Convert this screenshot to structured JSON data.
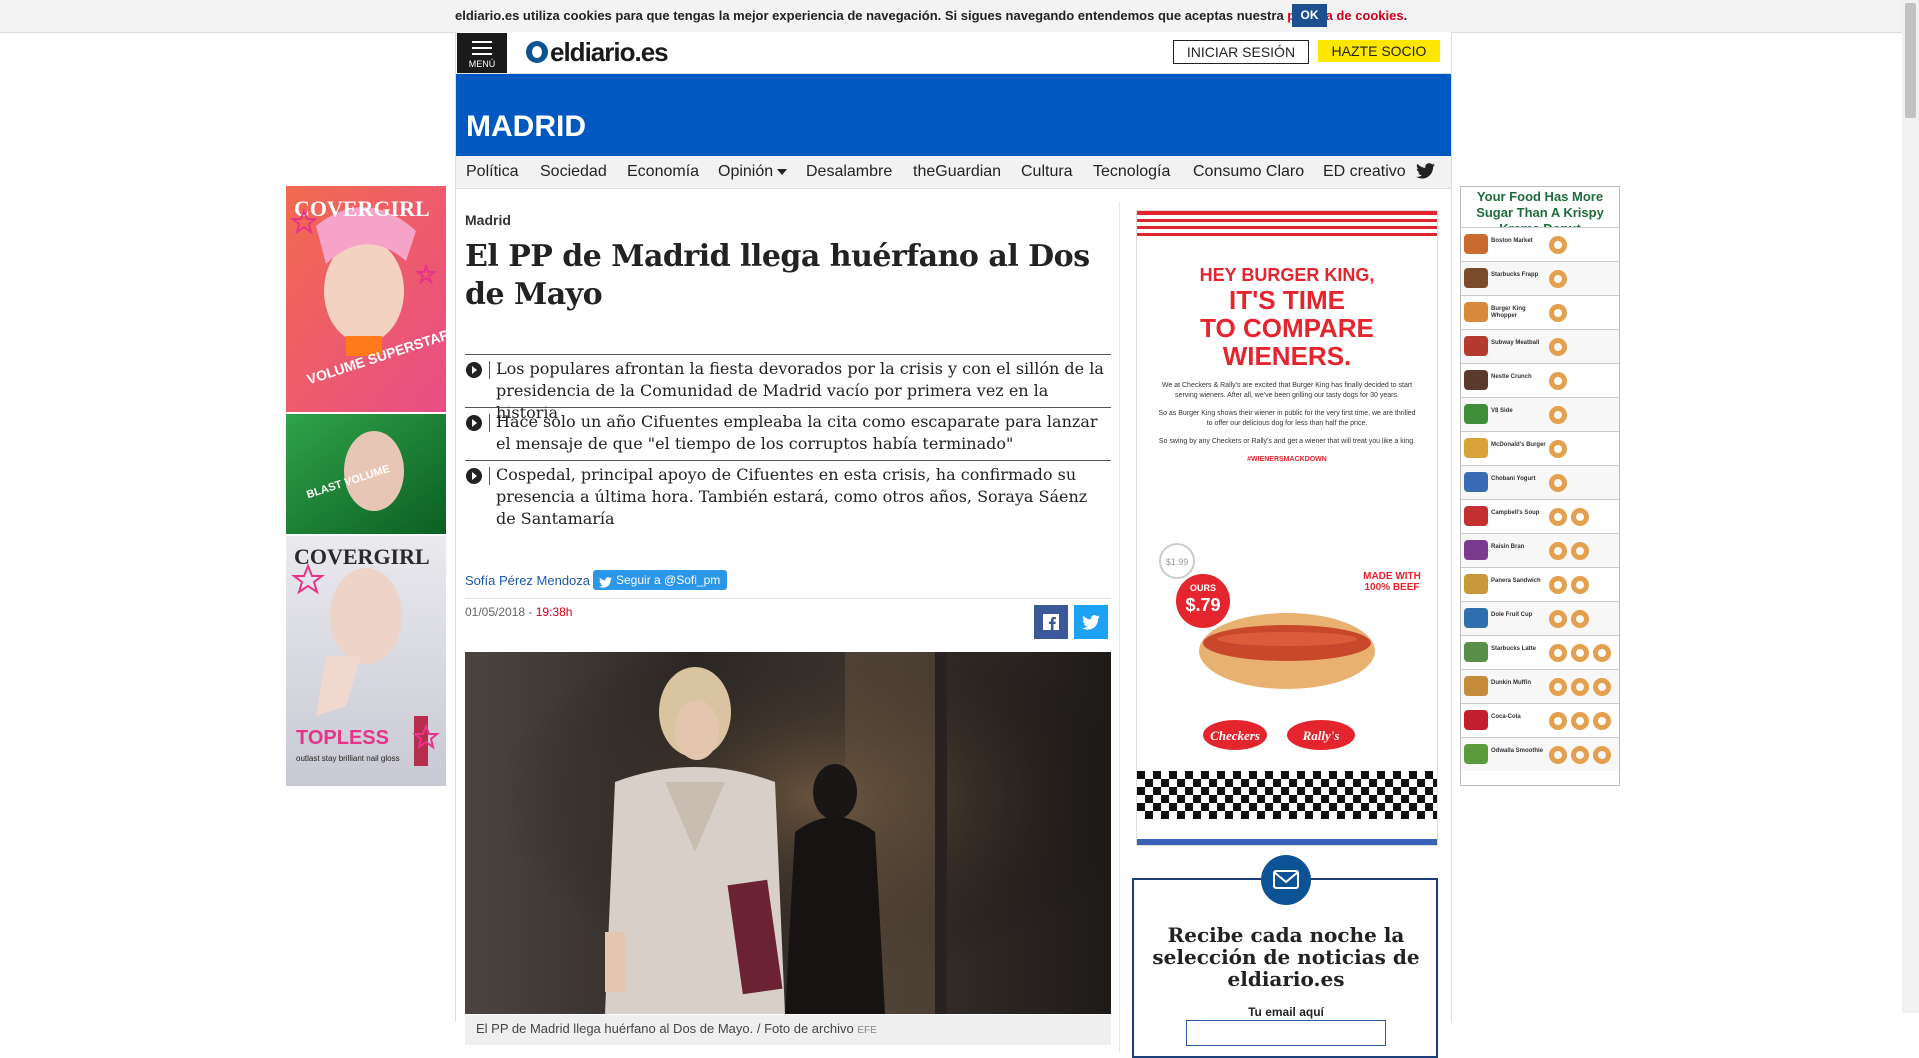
{
  "cookie_bar": {
    "text": "eldiario.es utiliza cookies para que tengas la mejor experiencia de navegación. Si sigues navegando entendemos que aceptas nuestra ",
    "link": "política de cookies",
    "period": ".",
    "ok_label": "OK"
  },
  "header": {
    "menu_label": "MENÚ",
    "logo_text": "eldiario.es",
    "login_label": "INICIAR SESIÓN",
    "join_label": "HAZTE SOCIO",
    "section_title": "MADRID"
  },
  "nav": {
    "items": [
      "Política",
      "Sociedad",
      "Economía",
      "Opinión",
      "Desalambre",
      "theGuardian",
      "Cultura",
      "Tecnología",
      "Consumo Claro",
      "ED creativo"
    ],
    "twitter_icon": "twitter-icon"
  },
  "article": {
    "kicker": "Madrid",
    "headline": "El PP de Madrid llega huérfano al Dos de Mayo",
    "summary": [
      "Los populares afrontan la fiesta devorados por la crisis y con el sillón de la presidencia de la Comunidad de Madrid vacío por primera vez en la historia",
      "Hace solo un año Cifuentes empleaba la cita como escaparate para lanzar el mensaje de que \"el tiempo de los corruptos había terminado\"",
      "Cospedal, principal apoyo de Cifuentes en esta crisis, ha confirmado su presencia a última hora. También estará, como otros años, Soraya Sáenz de Santamaría"
    ],
    "author": "Sofía Pérez Mendoza",
    "follow_label": "Seguir a @Sofi_pm",
    "date": "01/05/2018 - ",
    "time": "19:38h",
    "caption": "El PP de Madrid llega huérfano al Dos de Mayo. / Foto de archivo ",
    "caption_source": "EFE"
  },
  "ad_right_column": {
    "line1": "HEY BURGER KING,",
    "line2": "IT'S TIME",
    "line3": "TO COMPARE",
    "line4": "WIENERS.",
    "body": "We at Checkers & Rally's are excited that Burger King has finally decided to start serving wieners. After all, we've been grilling our tasty dogs for 30 years.",
    "body2": "So as Burger King shows their wiener in public for the very first time, we are thrilled to offer our delicious dog for less than half the price.",
    "body3": "So swing by any Checkers or Rally's and get a wiener that will treat you like a king.",
    "hashtag": "#WIENERSMACKDOWN",
    "price_theirs": "$1.99",
    "price_ours_label": "OURS",
    "price_ours": "$.79",
    "beef_label": "MADE WITH 100% BEEF",
    "brand1": "Checkers",
    "brand2": "Rally's"
  },
  "newsletter": {
    "title": "Recibe cada noche la selección de noticias de eldiario.es",
    "email_label": "Tu email aquí",
    "email_value": ""
  },
  "ad_left": {
    "brand": "COVERGIRL",
    "tag1": "VOLUME SUPERSTAR!",
    "tag2": "BLAST VOLUME",
    "tag3": "TOPLESS",
    "tag4": "outlast stay brilliant nail gloss"
  },
  "ad_right": {
    "headline": "Your Food Has More Sugar Than A Krispy Kreme Donut",
    "items": [
      "Boston Market",
      "Starbucks Frapp",
      "Burger King Whopper",
      "Subway Meatball",
      "Nestle Crunch",
      "V8 Side",
      "McDonald's Burger",
      "Chobani Yogurt",
      "Campbell's Soup",
      "Raisin Bran",
      "Panera Sandwich",
      "Dole Fruit Cup",
      "Starbucks Latte",
      "Dunkin Muffin",
      "Coca-Cola",
      "Odwalla Smoothie"
    ],
    "donut_counts": [
      1,
      1,
      1,
      1,
      1,
      1,
      1,
      1,
      2,
      2,
      2,
      2,
      3,
      3,
      3,
      3
    ]
  }
}
